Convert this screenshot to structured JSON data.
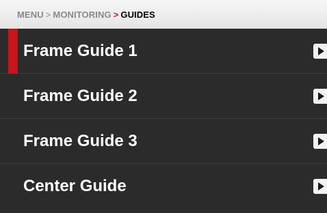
{
  "breadcrumb": {
    "items": [
      "MENU",
      "MONITORING",
      "GUIDES"
    ],
    "separator": ">"
  },
  "menu": {
    "items": [
      {
        "label": "Frame Guide 1",
        "selected": true
      },
      {
        "label": "Frame Guide 2",
        "selected": false
      },
      {
        "label": "Frame Guide 3",
        "selected": false
      },
      {
        "label": "Center Guide",
        "selected": false
      }
    ]
  },
  "colors": {
    "accent": "#c8141b",
    "background": "#2b2b2b",
    "breadcrumb_bar": "#eeeeee"
  },
  "icons": {
    "row_arrow": "chevron-right-icon"
  }
}
